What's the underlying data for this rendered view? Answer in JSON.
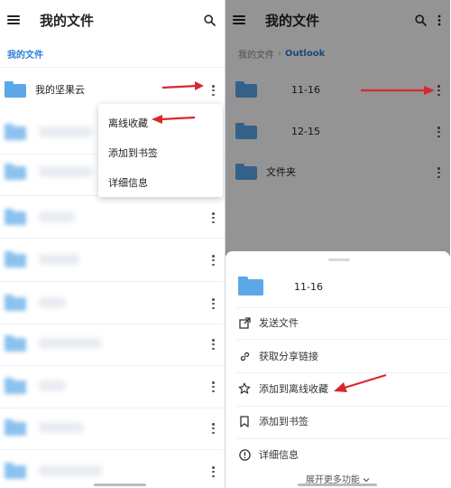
{
  "left": {
    "title": "我的文件",
    "breadcrumb": "我的文件",
    "first_row_label": "我的坚果云",
    "popup": [
      "离线收藏",
      "添加到书签",
      "详细信息"
    ]
  },
  "right": {
    "title": "我的文件",
    "breadcrumb": {
      "root": "我的文件",
      "current": "Outlook"
    },
    "rows": [
      "11-16",
      "12-15",
      "文件夹"
    ],
    "sheet": {
      "name": "11-16",
      "items": [
        "发送文件",
        "获取分享链接",
        "添加到离线收藏",
        "添加到书签",
        "详细信息"
      ],
      "expand": "展开更多功能"
    }
  },
  "colors": {
    "accent": "#2f7fd8",
    "folder": "#5aa8e8",
    "arrow": "#d8282e"
  }
}
